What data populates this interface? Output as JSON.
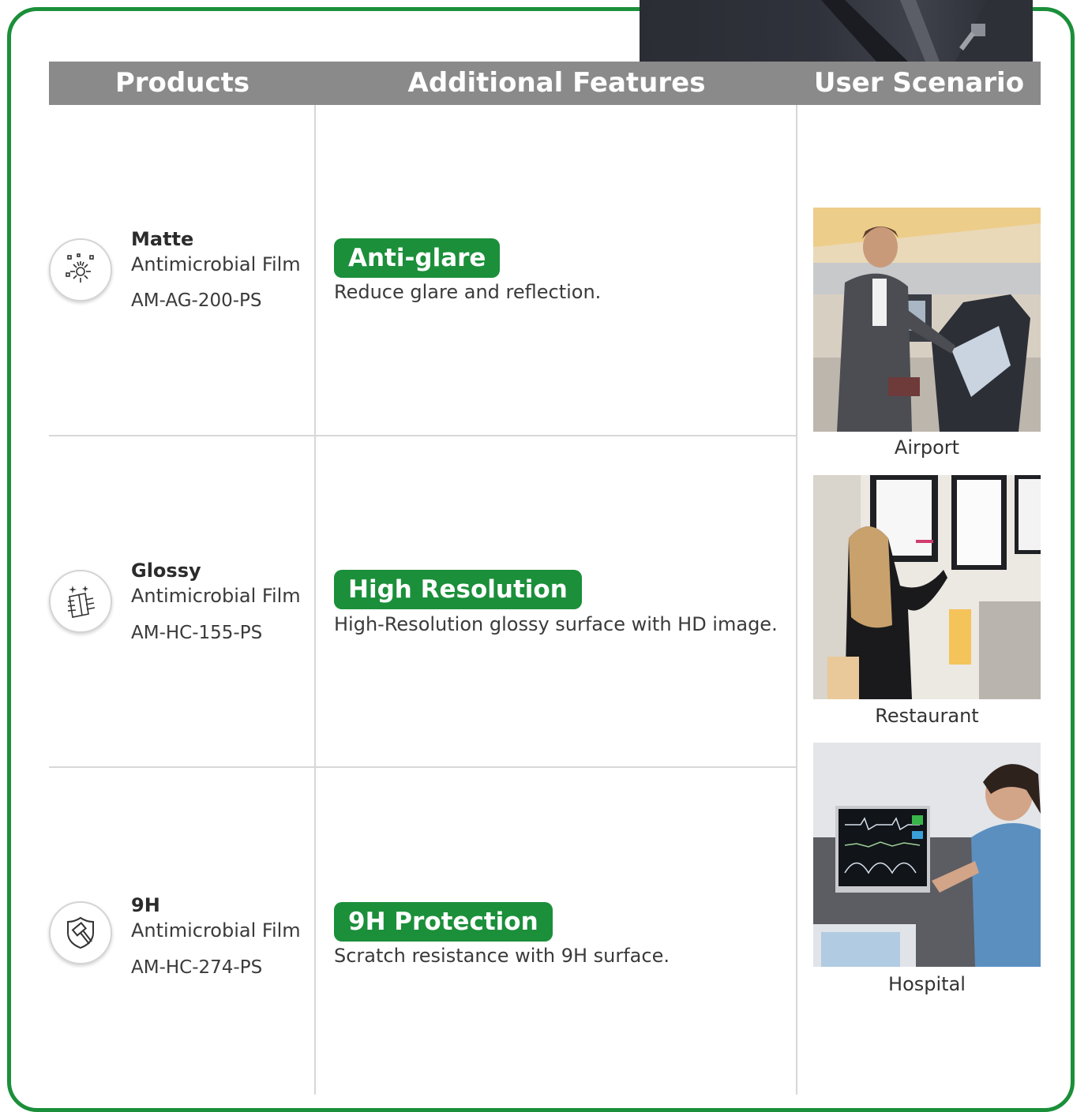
{
  "header": {
    "col1": "Products",
    "col2": "Additional Features",
    "col3": "User Scenario"
  },
  "rows": [
    {
      "icon": "sparkle-sun-icon",
      "name": "Matte",
      "type": "Antimicrobial Film",
      "code": "AM-AG-200-PS",
      "feature": "Anti-glare",
      "description": "Reduce glare and reflection."
    },
    {
      "icon": "glossy-surface-icon",
      "name": "Glossy",
      "type": "Antimicrobial Film",
      "code": "AM-HC-155-PS",
      "feature": "High Resolution",
      "description": "High-Resolution glossy surface with HD image."
    },
    {
      "icon": "shield-hammer-icon",
      "name": "9H",
      "type": "Antimicrobial Film",
      "code": "AM-HC-274-PS",
      "feature": "9H Protection",
      "description": "Scratch resistance with 9H surface."
    }
  ],
  "scenarios": [
    {
      "caption": "Airport"
    },
    {
      "caption": "Restaurant"
    },
    {
      "caption": "Hospital"
    }
  ],
  "colors": {
    "accent_green": "#1b8f3a",
    "header_gray": "#8a8a8a"
  }
}
